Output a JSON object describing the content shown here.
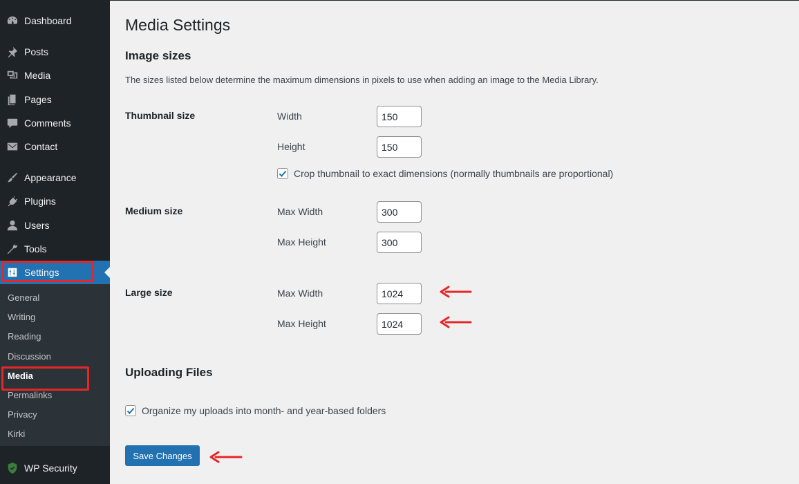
{
  "sidebar": {
    "menu": [
      {
        "label": "Dashboard",
        "icon": "dashboard-icon"
      },
      {
        "label": "Posts",
        "icon": "pin-icon"
      },
      {
        "label": "Media",
        "icon": "media-icon"
      },
      {
        "label": "Pages",
        "icon": "pages-icon"
      },
      {
        "label": "Comments",
        "icon": "comment-icon"
      },
      {
        "label": "Contact",
        "icon": "envelope-icon"
      },
      {
        "label": "Appearance",
        "icon": "brush-icon"
      },
      {
        "label": "Plugins",
        "icon": "plug-icon"
      },
      {
        "label": "Users",
        "icon": "user-icon"
      },
      {
        "label": "Tools",
        "icon": "wrench-icon"
      },
      {
        "label": "Settings",
        "icon": "settings-icon"
      },
      {
        "label": "WP Security",
        "icon": "shield-icon"
      }
    ],
    "submenu": [
      "General",
      "Writing",
      "Reading",
      "Discussion",
      "Media",
      "Permalinks",
      "Privacy",
      "Kirki"
    ]
  },
  "main": {
    "title": "Media Settings",
    "image_sizes": {
      "heading": "Image sizes",
      "description": "The sizes listed below determine the maximum dimensions in pixels to use when adding an image to the Media Library.",
      "thumbnail": {
        "label": "Thumbnail size",
        "width_label": "Width",
        "width": "150",
        "height_label": "Height",
        "height": "150",
        "crop_label": "Crop thumbnail to exact dimensions (normally thumbnails are proportional)",
        "crop_checked": true
      },
      "medium": {
        "label": "Medium size",
        "width_label": "Max Width",
        "width": "300",
        "height_label": "Max Height",
        "height": "300"
      },
      "large": {
        "label": "Large size",
        "width_label": "Max Width",
        "width": "1024",
        "height_label": "Max Height",
        "height": "1024"
      }
    },
    "uploading": {
      "heading": "Uploading Files",
      "organize_label": "Organize my uploads into month- and year-based folders",
      "organize_checked": true
    },
    "save_label": "Save Changes"
  },
  "colors": {
    "accent": "#2271b1",
    "sidebar_bg": "#1d2327",
    "annotation": "#e62628"
  }
}
